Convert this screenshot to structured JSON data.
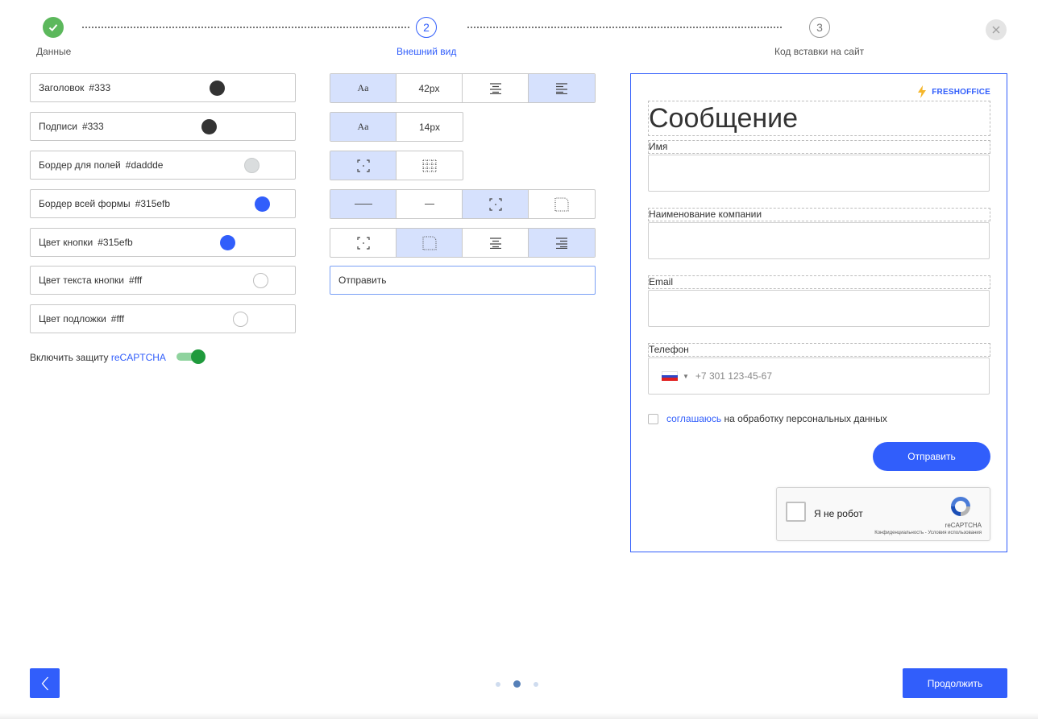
{
  "stepper": {
    "steps": [
      {
        "number": "",
        "label": "Данные",
        "state": "done"
      },
      {
        "number": "2",
        "label": "Внешний вид",
        "state": "active"
      },
      {
        "number": "3",
        "label": "Код вставки на сайт",
        "state": "todo"
      }
    ]
  },
  "colors": {
    "fields": [
      {
        "label": "Заголовок",
        "value": "#333",
        "swatch": "#333333"
      },
      {
        "label": "Подписи",
        "value": "#333",
        "swatch": "#333333"
      },
      {
        "label": "Бордер для полей",
        "value": "#daddde",
        "swatch": "#daddde"
      },
      {
        "label": "Бордер всей формы",
        "value": "#315efb",
        "swatch": "#315efb"
      },
      {
        "label": "Цвет кнопки",
        "value": "#315efb",
        "swatch": "#315efb"
      },
      {
        "label": "Цвет текста кнопки",
        "value": "#fff",
        "swatch": "#ffffff"
      },
      {
        "label": "Цвет подложки",
        "value": "#fff",
        "swatch": "#ffffff"
      }
    ],
    "captcha_toggle": {
      "prefix": "Включить защиту",
      "link": "reCAPTCHA",
      "enabled": true
    }
  },
  "style_controls": {
    "title_font": {
      "font_sample": "Aa",
      "size": "42px"
    },
    "label_font": {
      "font_sample": "Aa",
      "size": "14px"
    },
    "button_text": "Отправить"
  },
  "preview": {
    "brand": "FRESHOFFICE",
    "title": "Сообщение",
    "fields": [
      {
        "label": "Имя"
      },
      {
        "label": "Наименование компании"
      },
      {
        "label": "Email"
      },
      {
        "label": "Телефон",
        "placeholder": "+7 301 123-45-67"
      }
    ],
    "consent": {
      "link": "соглашаюсь",
      "text": "на обработку персональных данных"
    },
    "submit_label": "Отправить",
    "recaptcha": {
      "text": "Я не робот",
      "brand": "reCAPTCHA",
      "links": "Конфиденциальность - Условия использования"
    }
  },
  "footer": {
    "next_label": "Продолжить",
    "pages": 3,
    "current_page": 2
  },
  "theme": {
    "accent": "#315efb",
    "success": "#5cb85c",
    "selected_bg": "#d6e1fd"
  }
}
